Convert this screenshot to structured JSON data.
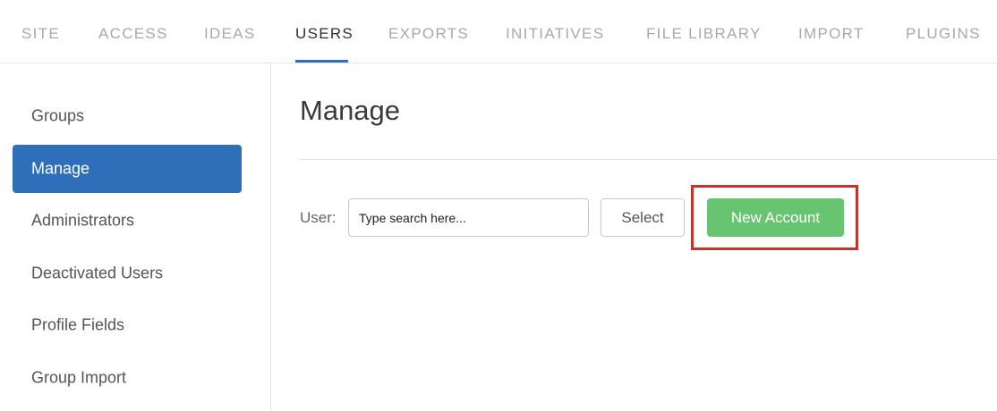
{
  "topnav": {
    "tabs": [
      {
        "label": "SITE"
      },
      {
        "label": "ACCESS"
      },
      {
        "label": "IDEAS"
      },
      {
        "label": "USERS",
        "active": true
      },
      {
        "label": "EXPORTS"
      },
      {
        "label": "INITIATIVES"
      },
      {
        "label": "FILE LIBRARY"
      },
      {
        "label": "IMPORT"
      },
      {
        "label": "PLUGINS"
      }
    ]
  },
  "sidebar": {
    "items": [
      {
        "label": "Groups"
      },
      {
        "label": "Manage",
        "active": true
      },
      {
        "label": "Administrators"
      },
      {
        "label": "Deactivated Users"
      },
      {
        "label": "Profile Fields"
      },
      {
        "label": "Group Import"
      }
    ]
  },
  "main": {
    "title": "Manage",
    "user_label": "User:",
    "search_placeholder": "Type search here...",
    "search_value": "",
    "select_label": "Select",
    "new_account_label": "New Account"
  },
  "colors": {
    "accent": "#2f6fba",
    "new_account_button": "#67c470",
    "highlight": "#c4342a"
  }
}
